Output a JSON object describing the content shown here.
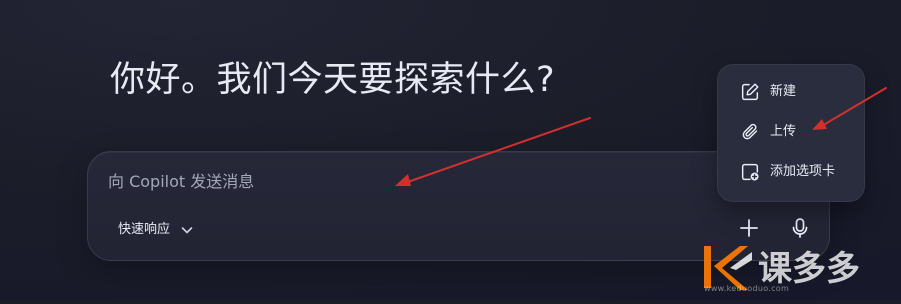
{
  "page": {
    "greeting": "你好。我们今天要探索什么?"
  },
  "composer": {
    "placeholder": "向 Copilot 发送消息",
    "mode_label": "快速响应",
    "add_icon": "plus-icon",
    "mic_icon": "microphone-icon"
  },
  "menu": {
    "items": [
      {
        "label": "新建",
        "icon": "new-chat-icon"
      },
      {
        "label": "上传",
        "icon": "paperclip-icon"
      },
      {
        "label": "添加选项卡",
        "icon": "add-tab-icon"
      }
    ]
  },
  "annotation": {
    "arrow_color": "#d0312d"
  },
  "watermark": {
    "text": "课多多",
    "subtext": "www.keduoduo.com",
    "accent_color": "#ff7a00"
  },
  "colors": {
    "background": "#1b1d29",
    "composer_bg": "#262839",
    "menu_bg": "#2a2d3e",
    "text_primary": "#e9ecf5",
    "text_placeholder": "#a3a8b9"
  }
}
